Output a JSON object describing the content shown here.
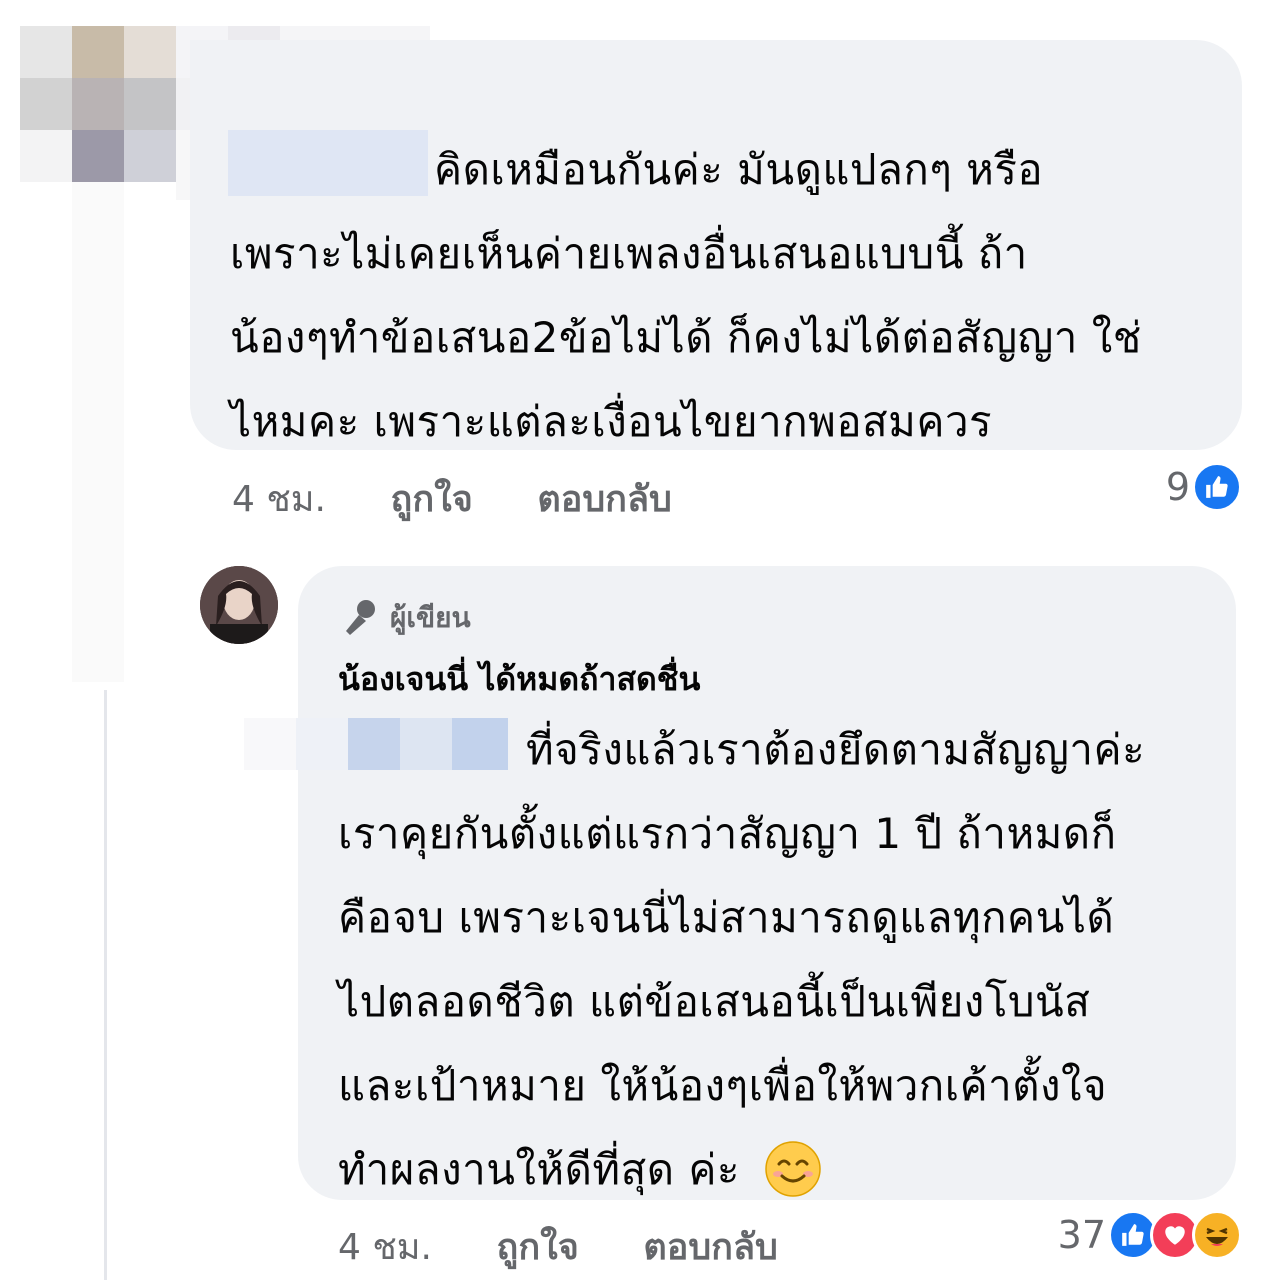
{
  "comment1": {
    "text_lines": [
      "คิดเหมือนกันค่ะ มันดูแปลกๆ หรือ",
      "เพราะไม่เคยเห็นค่ายเพลงอื่นเสนอแบบนี้ ถ้า",
      "น้องๆทำข้อเสนอ2ข้อไม่ได้ ก็คงไม่ได้ต่อสัญญา ใช่",
      "ไหมคะ เพราะแต่ละเงื่อนไขยากพอสมควร"
    ],
    "time": "4 ชม.",
    "like_label": "ถูกใจ",
    "reply_label": "ตอบกลับ",
    "reaction_count": "9",
    "reactions": [
      "like-icon"
    ]
  },
  "comment2": {
    "author_badge": "ผู้เขียน",
    "author_name": "น้องเจนนี่ ได้หมดถ้าสดชื่น",
    "text_lines": [
      "ที่จริงแล้วเราต้องยึดตามสัญญาค่ะ",
      "เราคุยกันตั้งแต่แรกว่าสัญญา 1 ปี ถ้าหมดก็",
      "คือจบ เพราะเจนนี่ไม่สามารถดูแลทุกคนได้",
      "ไปตลอดชีวิต แต่ข้อเสนอนี้เป็นเพียงโบนัส",
      "และเป้าหมาย ให้น้องๆเพื่อให้พวกเค้าตั้งใจ",
      "ทำผลงานให้ดีที่สุด ค่ะ"
    ],
    "emoji": "smiling-face-icon",
    "time": "4 ชม.",
    "like_label": "ถูกใจ",
    "reply_label": "ตอบกลับ",
    "reaction_count": "37",
    "reactions": [
      "like-icon",
      "love-icon",
      "haha-icon"
    ]
  },
  "colors": {
    "bubble": "#f0f2f5",
    "meta": "#65676b",
    "like": "#1877f2",
    "love": "#f33e58",
    "haha": "#f7b125"
  }
}
